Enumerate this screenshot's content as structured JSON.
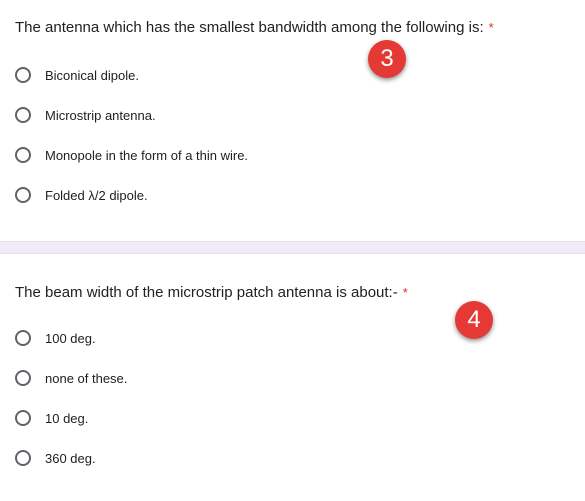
{
  "questions": [
    {
      "text": "The antenna which has the smallest bandwidth among the following is:",
      "required_mark": "*",
      "badge": "3",
      "options": [
        "Biconical dipole.",
        "Microstrip antenna.",
        "Monopole in the form of a thin wire.",
        "Folded λ/2 dipole."
      ]
    },
    {
      "text": "The beam width of the microstrip patch antenna is about:-",
      "required_mark": "*",
      "badge": "4",
      "options": [
        "100 deg.",
        "none of these.",
        "10 deg.",
        "360 deg."
      ]
    }
  ],
  "colors": {
    "required": "#d93025",
    "badge": "#e53935",
    "divider": "#f0ebf8"
  }
}
